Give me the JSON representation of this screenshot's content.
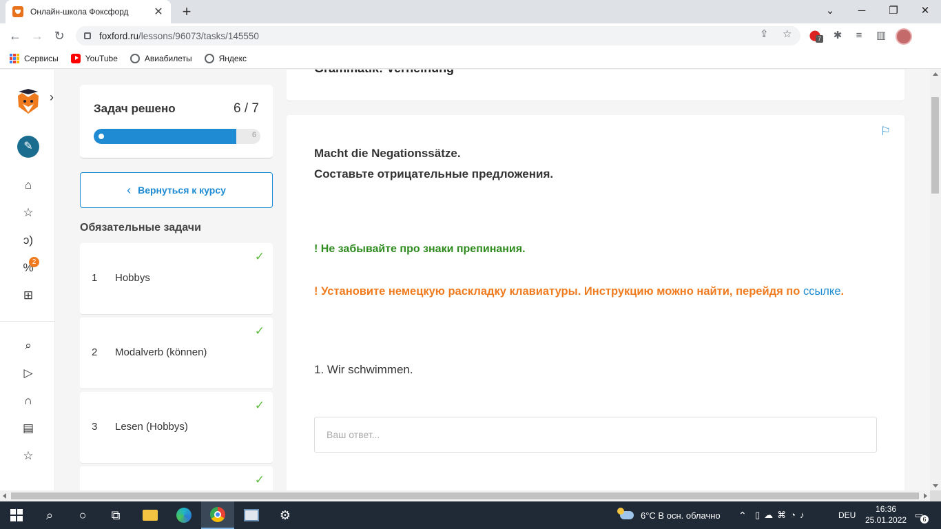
{
  "browser": {
    "tab_title": "Онлайн-школа Фоксфорд",
    "tab_close": "✕",
    "new_tab": "+",
    "url_host": "foxford.ru",
    "url_path": "/lessons/96073/tasks/145550",
    "extension_badge": "7"
  },
  "bookmarks": [
    {
      "label": "Сервисы",
      "icon": "apps-grid-icon"
    },
    {
      "label": "YouTube",
      "icon": "youtube-icon"
    },
    {
      "label": "Авиабилеты",
      "icon": "globe-icon"
    },
    {
      "label": "Яндекс",
      "icon": "globe-icon"
    }
  ],
  "rail": {
    "notifications_badge": "2"
  },
  "progress": {
    "label": "Задач решено",
    "count": "6 / 7",
    "solved": 6,
    "total": 7,
    "end_marker": "6",
    "color": "#1e8bd3"
  },
  "back_button": {
    "label": "Вернуться к курсу"
  },
  "tasks_section": {
    "title": "Обязательные задачи",
    "items": [
      {
        "num": "1",
        "name": "Hobbys",
        "done": true
      },
      {
        "num": "2",
        "name": "Modalverb (können)",
        "done": true
      },
      {
        "num": "3",
        "name": "Lesen (Hobbys)",
        "done": true
      },
      {
        "num": "",
        "name": "",
        "done": true
      }
    ]
  },
  "lesson": {
    "header_title": "Grammatik: Verneinung",
    "exercise_title_de": "Macht die Negationssätze.",
    "exercise_title_ru": "Составьте отрицательные предложения.",
    "note_punctuation": "! Не забывайте про знаки препинания.",
    "note_keyboard": " ! Установите немецкую раскладку клавиатуры. Инструкцию можно найти, перейдя по ",
    "note_link": "ссылке",
    "note_end": ".",
    "question": "1. Wir schwimmen.",
    "answer_placeholder": "Ваш ответ...",
    "colors": {
      "green": "#2e8b1e",
      "orange": "#f07b1f",
      "link": "#1e8bd3"
    }
  },
  "taskbar": {
    "weather": "6°C  В осн. облачно",
    "lang": "DEU",
    "time": "16:36",
    "date": "25.01.2022",
    "notifications": "6"
  }
}
